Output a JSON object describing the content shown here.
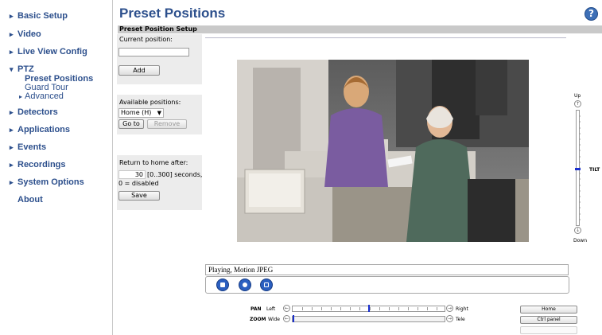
{
  "sidebar": {
    "items": [
      {
        "label": "Basic Setup",
        "expanded": false
      },
      {
        "label": "Video",
        "expanded": false
      },
      {
        "label": "Live View Config",
        "expanded": false
      },
      {
        "label": "PTZ",
        "expanded": true,
        "children": [
          "Preset Positions",
          "Guard Tour",
          "Advanced"
        ]
      },
      {
        "label": "Detectors",
        "expanded": false
      },
      {
        "label": "Applications",
        "expanded": false
      },
      {
        "label": "Events",
        "expanded": false
      },
      {
        "label": "Recordings",
        "expanded": false
      },
      {
        "label": "System Options",
        "expanded": false
      },
      {
        "label": "About",
        "expanded": null
      }
    ]
  },
  "header": {
    "title": "Preset Positions",
    "help_icon": "help-icon"
  },
  "setup": {
    "title": "Preset Position Setup",
    "current_position_label": "Current position:",
    "current_position_value": "",
    "add_label": "Add",
    "available_label": "Available positions:",
    "selected_position": "Home (H)",
    "goto_label": "Go to",
    "remove_label": "Remove",
    "return_label": "Return to home after:",
    "return_value": "30",
    "return_hint": "[0..300] seconds,",
    "return_hint2": "0 = disabled",
    "save_label": "Save"
  },
  "video": {
    "status": "Playing, Motion JPEG",
    "controls": [
      "stop-icon",
      "snapshot-icon",
      "fullscreen-icon"
    ]
  },
  "ptz": {
    "tilt_label": "TILT",
    "up_label": "Up",
    "down_label": "Down",
    "tilt_level": 0.5,
    "pan_label": "PAN",
    "pan_left": "Left",
    "pan_right": "Right",
    "pan_level": 0.5,
    "zoom_label": "ZOOM",
    "zoom_wide": "Wide",
    "zoom_tele": "Tele",
    "zoom_level": 0.0
  },
  "side_buttons": {
    "home_label": "Home",
    "ctrl_panel_label": "Ctrl panel"
  },
  "colors": {
    "link": "#2c4f8c",
    "accent": "#2b5fc0",
    "slider_thumb": "#1a2fcf"
  }
}
